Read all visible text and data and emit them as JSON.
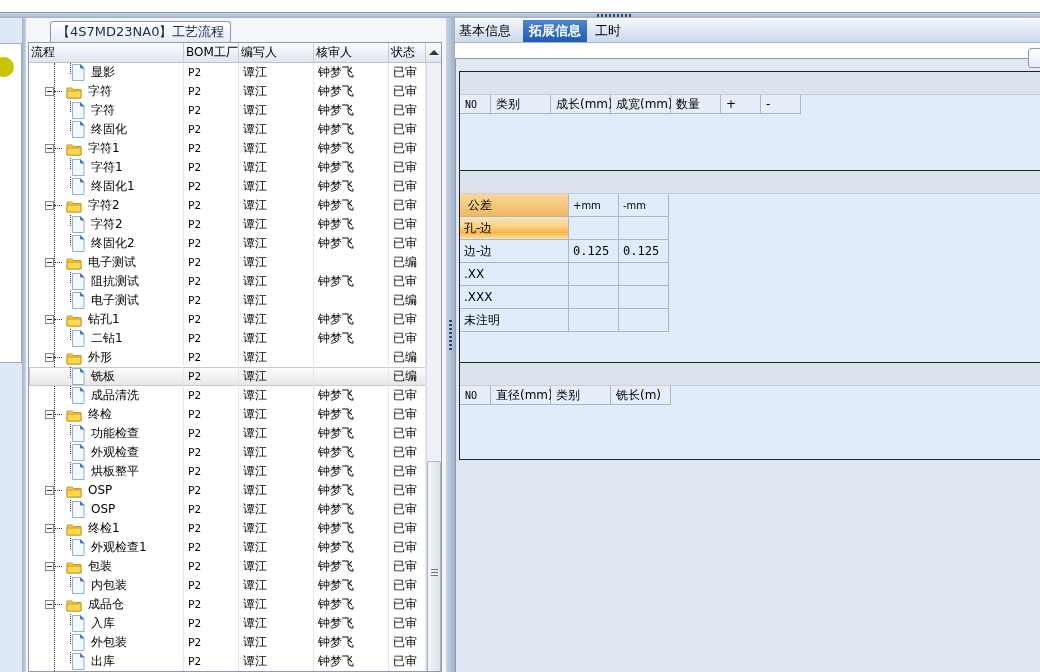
{
  "process_panel": {
    "title": "【4S7MD23NA0】工艺流程",
    "columns": [
      "流程",
      "BOM工厂",
      "编写人",
      "核审人",
      "状态"
    ],
    "tree": {
      "children_of_hidden_parent": [
        {
          "kind": "file",
          "label": "显影",
          "bom": "P2",
          "writer": "谭江",
          "reviewer": "钟梦飞",
          "status": "已审",
          "selected": false
        }
      ],
      "nodes": [
        {
          "kind": "folder",
          "expanded": true,
          "label": "字符",
          "bom": "P2",
          "writer": "谭江",
          "reviewer": "钟梦飞",
          "status": "已审",
          "selected": false,
          "children": [
            {
              "kind": "file",
              "label": "字符",
              "bom": "P2",
              "writer": "谭江",
              "reviewer": "钟梦飞",
              "status": "已审",
              "selected": false
            },
            {
              "kind": "file",
              "label": "终固化",
              "bom": "P2",
              "writer": "谭江",
              "reviewer": "钟梦飞",
              "status": "已审",
              "selected": false
            }
          ]
        },
        {
          "kind": "folder",
          "expanded": true,
          "label": "字符1",
          "bom": "P2",
          "writer": "谭江",
          "reviewer": "钟梦飞",
          "status": "已审",
          "selected": false,
          "children": [
            {
              "kind": "file",
              "label": "字符1",
              "bom": "P2",
              "writer": "谭江",
              "reviewer": "钟梦飞",
              "status": "已审",
              "selected": false
            },
            {
              "kind": "file",
              "label": "终固化1",
              "bom": "P2",
              "writer": "谭江",
              "reviewer": "钟梦飞",
              "status": "已审",
              "selected": false
            }
          ]
        },
        {
          "kind": "folder",
          "expanded": true,
          "label": "字符2",
          "bom": "P2",
          "writer": "谭江",
          "reviewer": "钟梦飞",
          "status": "已审",
          "selected": false,
          "children": [
            {
              "kind": "file",
              "label": "字符2",
              "bom": "P2",
              "writer": "谭江",
              "reviewer": "钟梦飞",
              "status": "已审",
              "selected": false
            },
            {
              "kind": "file",
              "label": "终固化2",
              "bom": "P2",
              "writer": "谭江",
              "reviewer": "钟梦飞",
              "status": "已审",
              "selected": false
            }
          ]
        },
        {
          "kind": "folder",
          "expanded": true,
          "label": "电子测试",
          "bom": "P2",
          "writer": "谭江",
          "status": "已编",
          "selected": false,
          "children": [
            {
              "kind": "file",
              "label": "阻抗测试",
              "bom": "P2",
              "writer": "谭江",
              "reviewer": "钟梦飞",
              "status": "已审",
              "selected": false
            },
            {
              "kind": "file",
              "label": "电子测试",
              "bom": "P2",
              "writer": "谭江",
              "status": "已编",
              "selected": false
            }
          ]
        },
        {
          "kind": "folder",
          "expanded": true,
          "label": "钻孔1",
          "bom": "P2",
          "writer": "谭江",
          "reviewer": "钟梦飞",
          "status": "已审",
          "selected": false,
          "children": [
            {
              "kind": "file",
              "label": "二钻1",
              "bom": "P2",
              "writer": "谭江",
              "reviewer": "钟梦飞",
              "status": "已审",
              "selected": false
            }
          ]
        },
        {
          "kind": "folder",
          "expanded": true,
          "label": "外形",
          "bom": "P2",
          "writer": "谭江",
          "status": "已编",
          "selected": false,
          "children": [
            {
              "kind": "file",
              "label": "铣板",
              "bom": "P2",
              "writer": "谭江",
              "status": "已编",
              "selected": true
            },
            {
              "kind": "file",
              "label": "成品清洗",
              "bom": "P2",
              "writer": "谭江",
              "reviewer": "钟梦飞",
              "status": "已审",
              "selected": false
            }
          ]
        },
        {
          "kind": "folder",
          "expanded": true,
          "label": "终检",
          "bom": "P2",
          "writer": "谭江",
          "reviewer": "钟梦飞",
          "status": "已审",
          "selected": false,
          "children": [
            {
              "kind": "file",
              "label": "功能检查",
              "bom": "P2",
              "writer": "谭江",
              "reviewer": "钟梦飞",
              "status": "已审",
              "selected": false
            },
            {
              "kind": "file",
              "label": "外观检查",
              "bom": "P2",
              "writer": "谭江",
              "reviewer": "钟梦飞",
              "status": "已审",
              "selected": false
            },
            {
              "kind": "file",
              "label": "烘板整平",
              "bom": "P2",
              "writer": "谭江",
              "reviewer": "钟梦飞",
              "status": "已审",
              "selected": false
            }
          ]
        },
        {
          "kind": "folder",
          "expanded": true,
          "label": "OSP",
          "bom": "P2",
          "writer": "谭江",
          "reviewer": "钟梦飞",
          "status": "已审",
          "selected": false,
          "children": [
            {
              "kind": "file",
              "label": "OSP",
              "bom": "P2",
              "writer": "谭江",
              "reviewer": "钟梦飞",
              "status": "已审",
              "selected": false
            }
          ]
        },
        {
          "kind": "folder",
          "expanded": true,
          "label": "终检1",
          "bom": "P2",
          "writer": "谭江",
          "reviewer": "钟梦飞",
          "status": "已审",
          "selected": false,
          "children": [
            {
              "kind": "file",
              "label": "外观检查1",
              "bom": "P2",
              "writer": "谭江",
              "reviewer": "钟梦飞",
              "status": "已审",
              "selected": false
            }
          ]
        },
        {
          "kind": "folder",
          "expanded": true,
          "label": "包装",
          "bom": "P2",
          "writer": "谭江",
          "reviewer": "钟梦飞",
          "status": "已审",
          "selected": false,
          "children": [
            {
              "kind": "file",
              "label": "内包装",
              "bom": "P2",
              "writer": "谭江",
              "reviewer": "钟梦飞",
              "status": "已审",
              "selected": false
            }
          ]
        },
        {
          "kind": "folder",
          "expanded": true,
          "label": "成品仓",
          "bom": "P2",
          "writer": "谭江",
          "reviewer": "钟梦飞",
          "status": "已审",
          "selected": false,
          "children": [
            {
              "kind": "file",
              "label": "入库",
              "bom": "P2",
              "writer": "谭江",
              "reviewer": "钟梦飞",
              "status": "已审",
              "selected": false
            },
            {
              "kind": "file",
              "label": "外包装",
              "bom": "P2",
              "writer": "谭江",
              "reviewer": "钟梦飞",
              "status": "已审",
              "selected": false
            },
            {
              "kind": "file",
              "label": "出库",
              "bom": "P2",
              "writer": "谭江",
              "reviewer": "钟梦飞",
              "status": "已审",
              "selected": false
            }
          ]
        }
      ]
    }
  },
  "detail_panel": {
    "tabs": [
      {
        "label": "基本信息",
        "selected": false
      },
      {
        "label": "拓展信息",
        "selected": true
      },
      {
        "label": "工时",
        "selected": false
      }
    ],
    "panel_table": {
      "columns": [
        "NO",
        "类别",
        "成长(mm)",
        "成宽(mm)",
        "数量",
        "+",
        "-"
      ]
    },
    "tolerance_table": {
      "columns": [
        "公差",
        "+mm",
        "-mm"
      ],
      "rows": [
        {
          "label": "孔-边",
          "selected": true
        },
        {
          "label": "边-边",
          "plus": "0.125",
          "minus": "0.125",
          "selected": false
        },
        {
          "label": ".XX",
          "selected": false
        },
        {
          "label": ".XXX",
          "selected": false
        },
        {
          "label": "未注明",
          "selected": false
        }
      ]
    },
    "milling_table": {
      "columns": [
        "NO",
        "直径(mm)",
        "类别",
        "铣长(m)"
      ]
    }
  }
}
